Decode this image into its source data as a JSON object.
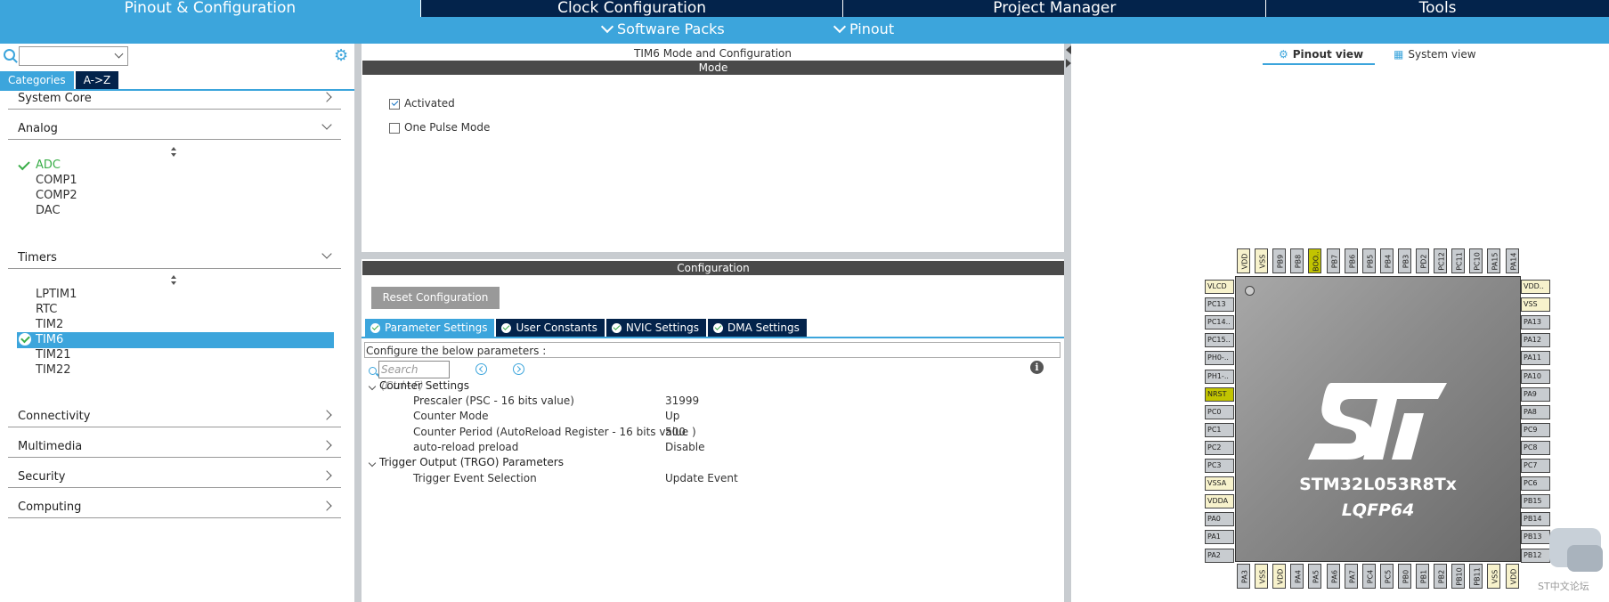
{
  "top_tabs": [
    "Pinout & Configuration",
    "Clock Configuration",
    "Project Manager",
    "Tools"
  ],
  "sub_menu": [
    "Software Packs",
    "Pinout"
  ],
  "left": {
    "category_tabs": [
      "Categories",
      "A->Z"
    ],
    "categories": {
      "system_core": "System Core",
      "analog": "Analog",
      "timers": "Timers",
      "connectivity": "Connectivity",
      "multimedia": "Multimedia",
      "security": "Security",
      "computing": "Computing"
    },
    "analog_items": [
      "ADC",
      "COMP1",
      "COMP2",
      "DAC"
    ],
    "timer_items": [
      "LPTIM1",
      "RTC",
      "TIM2",
      "TIM6",
      "TIM21",
      "TIM22"
    ]
  },
  "mid": {
    "title": "TIM6 Mode and Configuration",
    "mode_header": "Mode",
    "activated": "Activated",
    "one_pulse": "One Pulse Mode",
    "config_header": "Configuration",
    "reset_btn": "Reset Configuration",
    "param_tabs": [
      "Parameter Settings",
      "User Constants",
      "NVIC Settings",
      "DMA Settings"
    ],
    "configure_text": "Configure the below parameters :",
    "search_placeholder": "Search (Ctrl+F)",
    "groups": [
      "Counter Settings",
      "Trigger Output (TRGO) Parameters"
    ],
    "params": [
      {
        "name": "Prescaler (PSC - 16 bits value)",
        "value": "31999"
      },
      {
        "name": "Counter Mode",
        "value": "Up"
      },
      {
        "name": "Counter Period (AutoReload Register - 16 bits value )",
        "value": "500"
      },
      {
        "name": "auto-reload preload",
        "value": "Disable"
      },
      {
        "name": "Trigger Event Selection",
        "value": "Update Event"
      }
    ]
  },
  "right": {
    "view_tabs": [
      "Pinout view",
      "System view"
    ],
    "chip_name": "STM32L053R8Tx",
    "chip_package": "LQFP64",
    "pins_top": [
      "VDD",
      "VSS",
      "PB9",
      "PB8",
      "BOO..",
      "PB7",
      "PB6",
      "PB5",
      "PB4",
      "PB3",
      "PD2",
      "PC12",
      "PC11",
      "PC10",
      "PA15",
      "PA14"
    ],
    "pins_left": [
      "VLCD",
      "PC13",
      "PC14..",
      "PC15..",
      "PH0-..",
      "PH1-..",
      "NRST",
      "PC0",
      "PC1",
      "PC2",
      "PC3",
      "VSSA",
      "VDDA",
      "PA0",
      "PA1",
      "PA2"
    ],
    "pins_right": [
      "VDD..",
      "VSS",
      "PA13",
      "PA12",
      "PA11",
      "PA10",
      "PA9",
      "PA8",
      "PC9",
      "PC8",
      "PC7",
      "PC6",
      "PB15",
      "PB14",
      "PB13",
      "PB12"
    ],
    "pins_bottom": [
      "PA3",
      "VSS",
      "VDD",
      "PA4",
      "PA5",
      "PA6",
      "PA7",
      "PC4",
      "PC5",
      "PB0",
      "PB1",
      "PB2",
      "PB10",
      "PB11",
      "VSS",
      "VDD"
    ],
    "watermark": "ST中文论坛"
  }
}
